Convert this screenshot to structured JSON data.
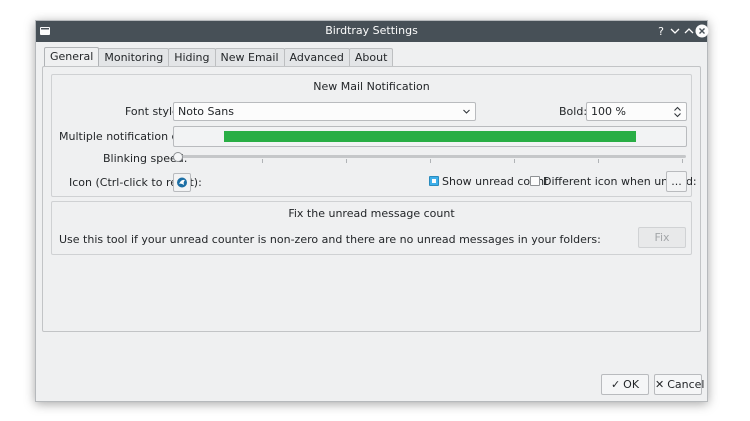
{
  "window": {
    "title": "Birdtray Settings"
  },
  "tabs": [
    {
      "label": "General"
    },
    {
      "label": "Monitoring"
    },
    {
      "label": "Hiding"
    },
    {
      "label": "New Email"
    },
    {
      "label": "Advanced"
    },
    {
      "label": "About"
    }
  ],
  "notification": {
    "title": "New Mail Notification",
    "font_style_label": "Font style:",
    "font_style_value": "Noto Sans",
    "bold_label": "Bold:",
    "bold_value": "100 %",
    "color_label": "Multiple notification color:",
    "color_value": "#29ae45",
    "blink_label": "Blinking speed:",
    "blink_speed": 0,
    "icon_label": "Icon (Ctrl-click to reset):",
    "show_unread_label": "Show unread count",
    "show_unread_checked": true,
    "diff_icon_label": "Different icon when unread:",
    "diff_icon_checked": false,
    "diff_icon_button": "..."
  },
  "fix": {
    "title": "Fix the unread message count",
    "description": "Use this tool if your unread counter is non-zero and there are no unread messages in your folders:",
    "button": "Fix"
  },
  "buttons": {
    "ok": "OK",
    "cancel": "Cancel"
  },
  "colors": {
    "accent": "#3daee9",
    "titlebar": "#475057",
    "notification_green": "#29ae45"
  }
}
